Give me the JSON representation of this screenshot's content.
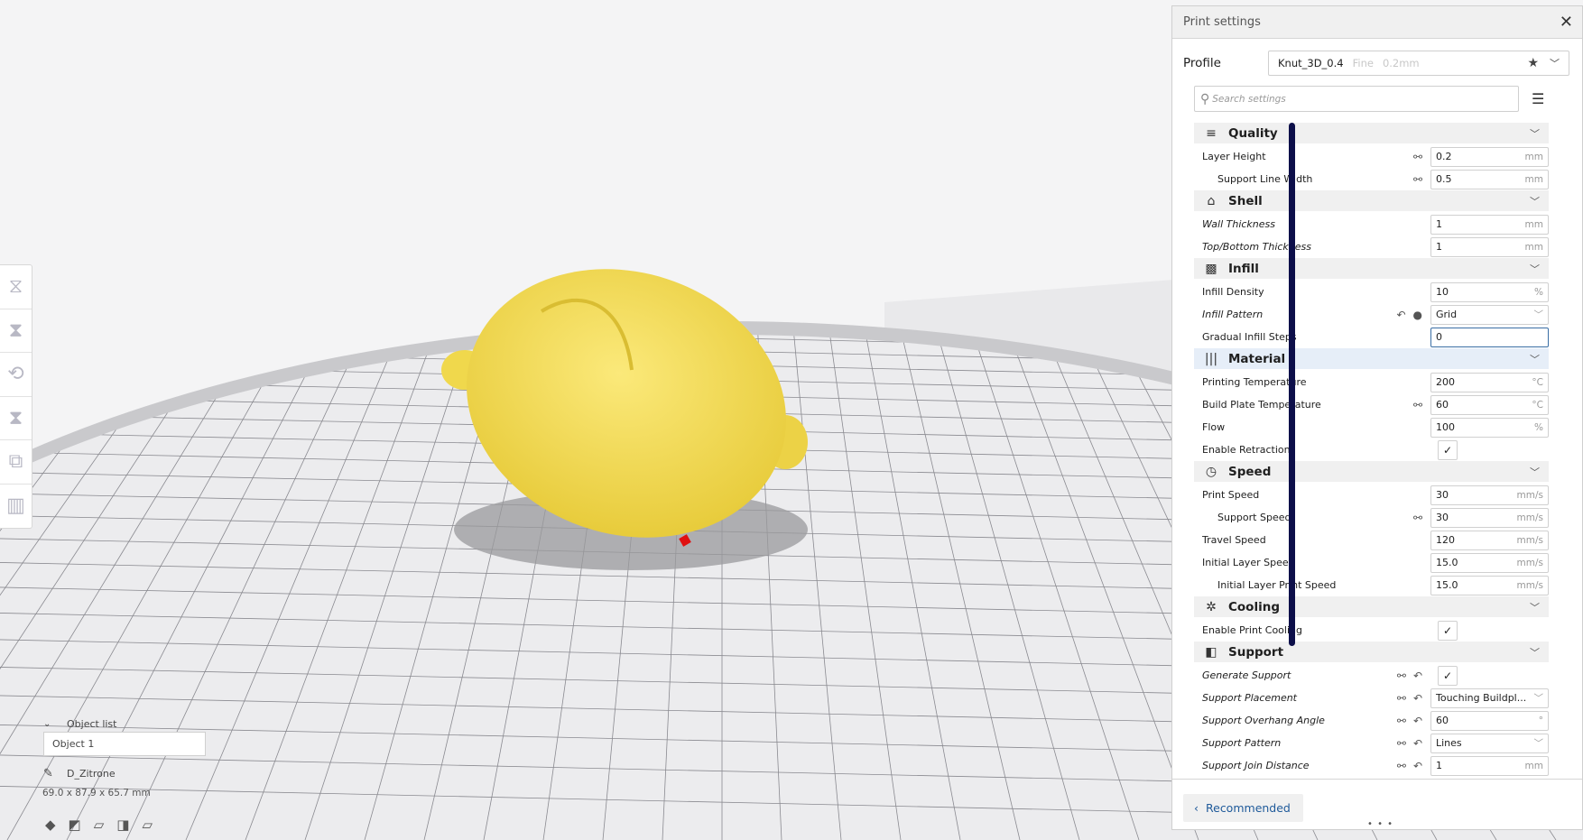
{
  "viewport": {
    "toolbar": [
      "scale-icon",
      "mirror-icon",
      "rotate-icon",
      "per-model-settings-icon",
      "support-blocker-icon",
      "support-icon"
    ],
    "object_list": {
      "header": "Object list",
      "items": [
        "Object 1"
      ],
      "object_name": "D_Zitrone",
      "dimensions": "69.0 x 87.9 x 65.7 mm"
    },
    "colors": {
      "lemon": "#f5e05a",
      "plate": "#e8e8ea",
      "grid": "#7a7a80"
    }
  },
  "panel": {
    "title": "Print settings",
    "profile_label": "Profile",
    "profile_name": "Knut_3D_0.4",
    "profile_quality": "Fine",
    "profile_layer": "0.2mm",
    "search_placeholder": "Search settings",
    "recommended": "Recommended",
    "rows": [
      {
        "type": "h",
        "label": "Quality",
        "icon": "≡"
      },
      {
        "label": "Layer Height",
        "value": "0.2",
        "unit": "mm",
        "link": true
      },
      {
        "label": "Support Line Width",
        "value": "0.5",
        "unit": "mm",
        "link": true,
        "indent": true
      },
      {
        "type": "h",
        "label": "Shell",
        "icon": "⌂"
      },
      {
        "label": "Wall Thickness",
        "value": "1",
        "unit": "mm",
        "italic": true
      },
      {
        "label": "Top/Bottom Thickness",
        "value": "1",
        "unit": "mm",
        "italic": true
      },
      {
        "type": "h",
        "label": "Infill",
        "icon": "▩"
      },
      {
        "label": "Infill Density",
        "value": "10",
        "unit": "%"
      },
      {
        "label": "Infill Pattern",
        "value": "Grid",
        "select": true,
        "italic": true,
        "reset": true,
        "fx": true
      },
      {
        "label": "Gradual Infill Steps",
        "value": "0",
        "unit": "",
        "focus": true
      },
      {
        "type": "h",
        "label": "Material",
        "icon": "|||",
        "active": true
      },
      {
        "label": "Printing Temperature",
        "value": "200",
        "unit": "°C"
      },
      {
        "label": "Build Plate Temperature",
        "value": "60",
        "unit": "°C",
        "link": true
      },
      {
        "label": "Flow",
        "value": "100",
        "unit": "%"
      },
      {
        "label": "Enable Retraction",
        "check": true
      },
      {
        "type": "h",
        "label": "Speed",
        "icon": "◷"
      },
      {
        "label": "Print Speed",
        "value": "30",
        "unit": "mm/s"
      },
      {
        "label": "Support Speed",
        "value": "30",
        "unit": "mm/s",
        "link": true,
        "indent": true
      },
      {
        "label": "Travel Speed",
        "value": "120",
        "unit": "mm/s"
      },
      {
        "label": "Initial Layer Speed",
        "value": "15.0",
        "unit": "mm/s"
      },
      {
        "label": "Initial Layer Print Speed",
        "value": "15.0",
        "unit": "mm/s",
        "indent": true
      },
      {
        "type": "h",
        "label": "Cooling",
        "icon": "✲"
      },
      {
        "label": "Enable Print Cooling",
        "check": true
      },
      {
        "type": "h",
        "label": "Support",
        "icon": "◧"
      },
      {
        "label": "Generate Support",
        "check": true,
        "italic": true,
        "link": true,
        "reset": true
      },
      {
        "label": "Support Placement",
        "value": "Touching Buildpl...",
        "select": true,
        "italic": true,
        "link": true,
        "reset": true
      },
      {
        "label": "Support Overhang Angle",
        "value": "60",
        "unit": "°",
        "italic": true,
        "link": true,
        "reset": true
      },
      {
        "label": "Support Pattern",
        "value": "Lines",
        "select": true,
        "italic": true,
        "link": true,
        "reset": true
      },
      {
        "label": "Support Join Distance",
        "value": "1",
        "unit": "mm",
        "italic": true,
        "link": true,
        "reset": true
      }
    ]
  }
}
